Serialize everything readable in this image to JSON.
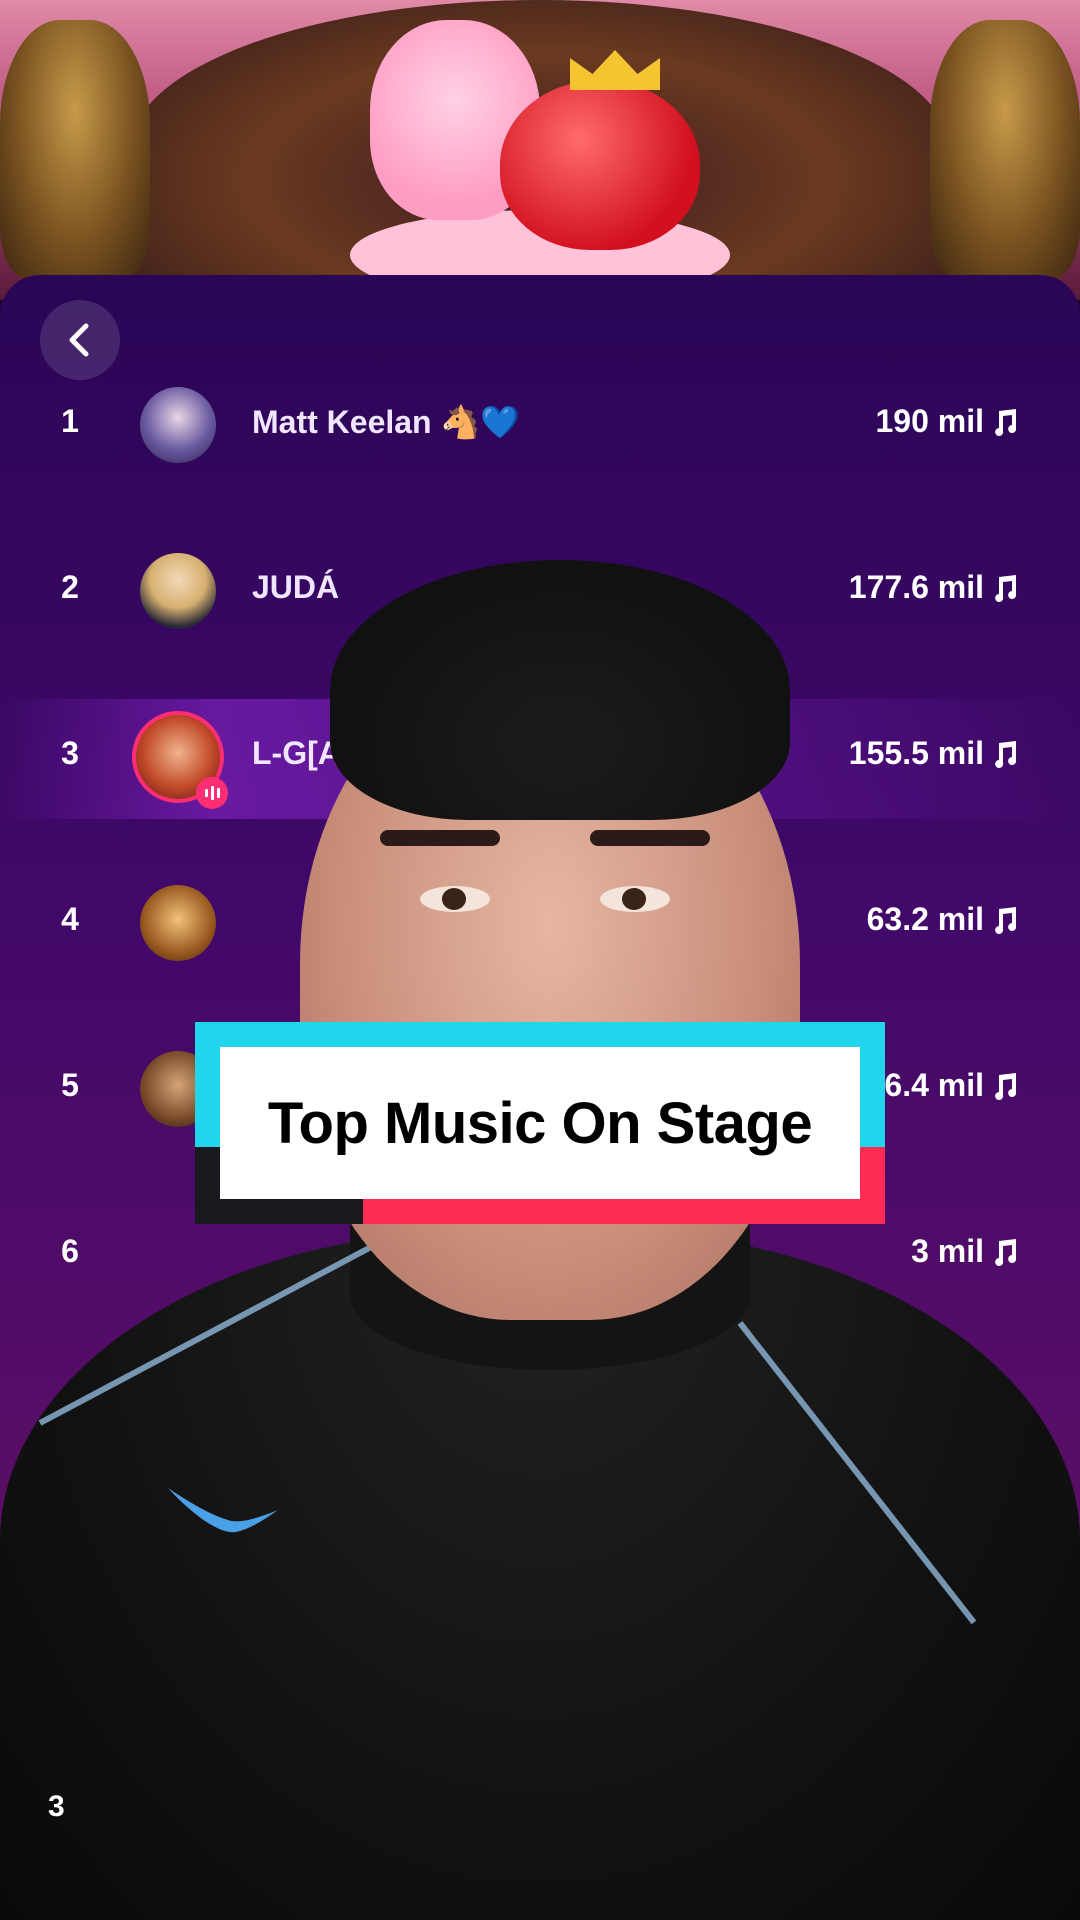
{
  "leaderboard": {
    "rows": [
      {
        "rank": "1",
        "name": "Matt Keelan 🐴💙",
        "score": "190 mil"
      },
      {
        "rank": "2",
        "name": "JUDÁ",
        "score": "177.6 mil"
      },
      {
        "rank": "3",
        "name": "L-G[A",
        "score": "155.5 mil"
      },
      {
        "rank": "4",
        "name": "",
        "score": "63.2 mil"
      },
      {
        "rank": "5",
        "name": "",
        "score": "6.4 mil"
      },
      {
        "rank": "6",
        "name": "",
        "score": "3 mil"
      }
    ],
    "footer_rank": "3"
  },
  "caption": {
    "text": "Top Music On Stage"
  },
  "colors": {
    "caption_cyan": "#20d5ec",
    "caption_red": "#fe2c55",
    "live_ring": "#ff2e73",
    "panel_top": "#2a0656"
  },
  "icons": {
    "back": "chevron-left-icon",
    "score": "music-note-icon",
    "live": "live-audio-icon",
    "brand": "swoosh-icon"
  }
}
